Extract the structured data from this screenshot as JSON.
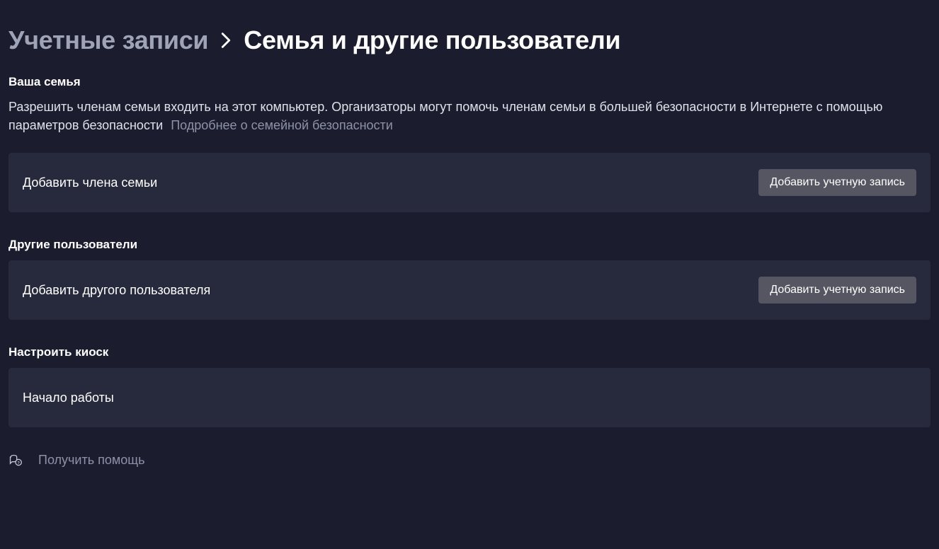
{
  "breadcrumb": {
    "parent": "Учетные записи",
    "current": "Семья и другие пользователи"
  },
  "family": {
    "heading": "Ваша семья",
    "description": "Разрешить членам семьи входить на этот компьютер. Организаторы могут помочь членам семьи в большей безопасности в Интернете с помощью параметров безопасности",
    "link": "Подробнее о семейной безопасности",
    "card_label": "Добавить члена семьи",
    "card_button": "Добавить учетную запись"
  },
  "other": {
    "heading": "Другие пользователи",
    "card_label": "Добавить другого пользователя",
    "card_button": "Добавить учетную запись"
  },
  "kiosk": {
    "heading": "Настроить киоск",
    "card_label": "Начало работы"
  },
  "help": {
    "label": "Получить помощь"
  }
}
